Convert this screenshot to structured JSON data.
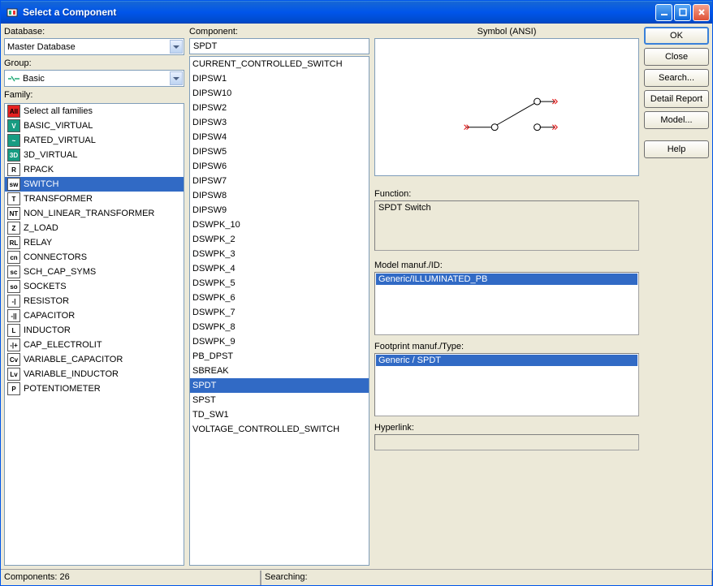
{
  "window": {
    "title": "Select a Component"
  },
  "labels": {
    "database": "Database:",
    "group": "Group:",
    "family": "Family:",
    "component": "Component:",
    "symbol": "Symbol (ANSI)",
    "function": "Function:",
    "model": "Model manuf./ID:",
    "footprint": "Footprint manuf./Type:",
    "hyperlink": "Hyperlink:"
  },
  "database": {
    "selected": "Master Database"
  },
  "group": {
    "selected": "Basic"
  },
  "families": [
    {
      "icon": "All",
      "label": "Select all families",
      "iconbg": "#E62020",
      "iconfg": "#000"
    },
    {
      "icon": "V",
      "label": "BASIC_VIRTUAL",
      "iconbg": "#179C82",
      "iconfg": "#FFF"
    },
    {
      "icon": "~",
      "label": "RATED_VIRTUAL",
      "iconbg": "#179C82",
      "iconfg": "#FFF"
    },
    {
      "icon": "3D",
      "label": "3D_VIRTUAL",
      "iconbg": "#179C82",
      "iconfg": "#FFF"
    },
    {
      "icon": "R",
      "label": "RPACK",
      "iconbg": "#FFF",
      "iconfg": "#000"
    },
    {
      "icon": "sw",
      "label": "SWITCH",
      "iconbg": "#FFF",
      "iconfg": "#000",
      "selected": true
    },
    {
      "icon": "T",
      "label": "TRANSFORMER",
      "iconbg": "#FFF",
      "iconfg": "#000"
    },
    {
      "icon": "NT",
      "label": "NON_LINEAR_TRANSFORMER",
      "iconbg": "#FFF",
      "iconfg": "#000"
    },
    {
      "icon": "Z",
      "label": "Z_LOAD",
      "iconbg": "#FFF",
      "iconfg": "#000"
    },
    {
      "icon": "RL",
      "label": "RELAY",
      "iconbg": "#FFF",
      "iconfg": "#000"
    },
    {
      "icon": "cn",
      "label": "CONNECTORS",
      "iconbg": "#FFF",
      "iconfg": "#000"
    },
    {
      "icon": "sc",
      "label": "SCH_CAP_SYMS",
      "iconbg": "#FFF",
      "iconfg": "#000"
    },
    {
      "icon": "so",
      "label": "SOCKETS",
      "iconbg": "#FFF",
      "iconfg": "#000"
    },
    {
      "icon": "-|",
      "label": "RESISTOR",
      "iconbg": "#FFF",
      "iconfg": "#000"
    },
    {
      "icon": "-||",
      "label": "CAPACITOR",
      "iconbg": "#FFF",
      "iconfg": "#000"
    },
    {
      "icon": "L",
      "label": "INDUCTOR",
      "iconbg": "#FFF",
      "iconfg": "#000"
    },
    {
      "icon": "-|+",
      "label": "CAP_ELECTROLIT",
      "iconbg": "#FFF",
      "iconfg": "#000"
    },
    {
      "icon": "Cv",
      "label": "VARIABLE_CAPACITOR",
      "iconbg": "#FFF",
      "iconfg": "#000"
    },
    {
      "icon": "Lv",
      "label": "VARIABLE_INDUCTOR",
      "iconbg": "#FFF",
      "iconfg": "#000"
    },
    {
      "icon": "P",
      "label": "POTENTIOMETER",
      "iconbg": "#FFF",
      "iconfg": "#000"
    }
  ],
  "componentSearch": "SPDT",
  "components": [
    "CURRENT_CONTROLLED_SWITCH",
    "DIPSW1",
    "DIPSW10",
    "DIPSW2",
    "DIPSW3",
    "DIPSW4",
    "DIPSW5",
    "DIPSW6",
    "DIPSW7",
    "DIPSW8",
    "DIPSW9",
    "DSWPK_10",
    "DSWPK_2",
    "DSWPK_3",
    "DSWPK_4",
    "DSWPK_5",
    "DSWPK_6",
    "DSWPK_7",
    "DSWPK_8",
    "DSWPK_9",
    "PB_DPST",
    "SBREAK",
    "SPDT",
    "SPST",
    "TD_SW1",
    "VOLTAGE_CONTROLLED_SWITCH"
  ],
  "componentSelected": "SPDT",
  "function": {
    "value": "SPDT Switch"
  },
  "modelManuf": "Generic/ILLUMINATED_PB",
  "footprintManuf": "Generic / SPDT",
  "hyperlink": "",
  "buttons": {
    "ok": "OK",
    "close": "Close",
    "search": "Search...",
    "detail": "Detail Report",
    "model": "Model...",
    "help": "Help"
  },
  "status": {
    "components": "Components: 26",
    "searching": "Searching:"
  }
}
